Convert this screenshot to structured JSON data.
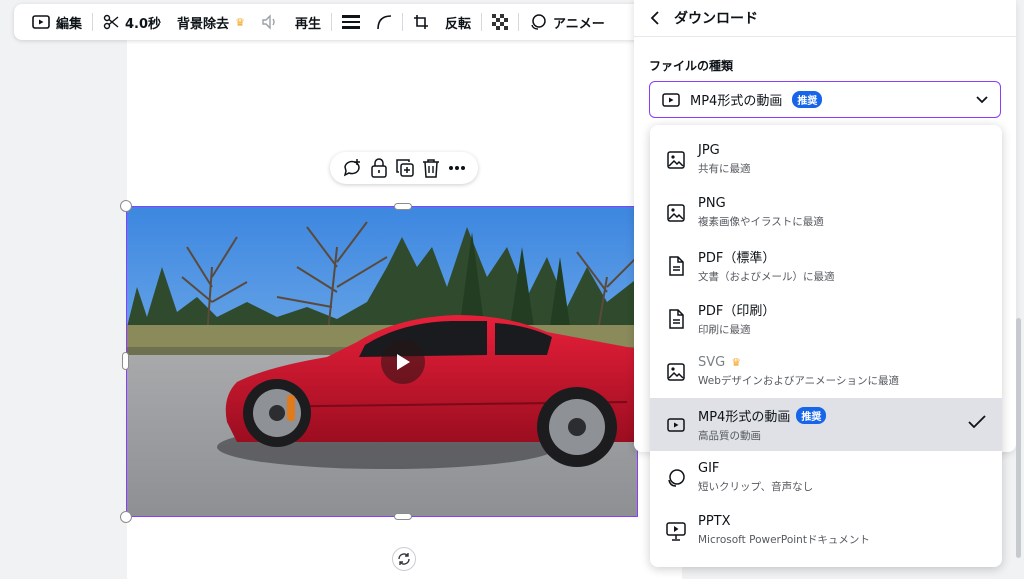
{
  "toolbar": {
    "edit_label": "編集",
    "duration_label": "4.0秒",
    "bg_remove_label": "背景除去",
    "playback_label": "再生",
    "flip_label": "反転",
    "animate_label": "アニメー"
  },
  "panel": {
    "title": "ダウンロード",
    "filetype_label": "ファイルの種類",
    "selected_value": "MP4形式の動画",
    "recommended_badge": "推奨"
  },
  "options": [
    {
      "title": "JPG",
      "sub": "共有に最適",
      "icon": "image-icon"
    },
    {
      "title": "PNG",
      "sub": "複素画像やイラストに最適",
      "icon": "image-icon"
    },
    {
      "title": "PDF（標準）",
      "sub": "文書（およびメール）に最適",
      "icon": "document-icon"
    },
    {
      "title": "PDF（印刷）",
      "sub": "印刷に最適",
      "icon": "document-icon"
    },
    {
      "title": "SVG",
      "sub": "Webデザインおよびアニメーションに最適",
      "icon": "image-icon"
    },
    {
      "title": "MP4形式の動画",
      "sub": "高品質の動画",
      "badge": "推奨",
      "icon": "video-icon"
    },
    {
      "title": "GIF",
      "sub": "短いクリップ、音声なし",
      "icon": "gif-icon"
    },
    {
      "title": "PPTX",
      "sub": "Microsoft PowerPointドキュメント",
      "icon": "presentation-icon"
    }
  ],
  "colors": {
    "accent": "#8b3dff",
    "badge": "#1765e8",
    "crown": "#f5a623",
    "selected_bg": "#dfe1e6"
  }
}
